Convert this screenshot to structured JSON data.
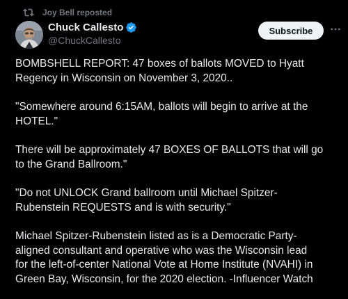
{
  "repost": {
    "icon": "repost-icon",
    "text": "Joy Bell reposted"
  },
  "author": {
    "display_name": "Chuck Callesto",
    "handle": "@ChuckCallesto",
    "verified_icon": "verified-badge-icon",
    "verified_color": "#1d9bf0"
  },
  "actions": {
    "subscribe_label": "Subscribe",
    "more_icon": "more-horizontal-icon"
  },
  "post": {
    "paragraphs": [
      [
        "BOMBSHELL REPORT: 47 boxes of ballots MOVED to Hyatt",
        "Regency in Wisconsin on November 3, 2020.."
      ],
      [
        "\"Somewhere around 6:15AM, ballots will begin to arrive at the",
        "HOTEL.\""
      ],
      [
        "There will be approximately 47 BOXES OF BALLOTS that will go",
        "to the Grand Ballroom.\""
      ],
      [
        "\"Do not UNLOCK Grand ballroom until Michael Spitzer-",
        "Rubenstein REQUESTS and is with security.\""
      ],
      [
        "Michael Spitzer-Rubenstein listed as  is a Democratic Party-",
        "aligned consultant and operative who was the Wisconsin lead",
        "for the left-of-center National Vote at Home Institute (NVAHI) in",
        "Green Bay, Wisconsin, for the 2020 election. -Influencer Watch"
      ]
    ]
  },
  "theme": {
    "background": "#000000",
    "text": "#e7e9ea",
    "secondary_text": "#71767b",
    "button_bg": "#eff3f4"
  }
}
